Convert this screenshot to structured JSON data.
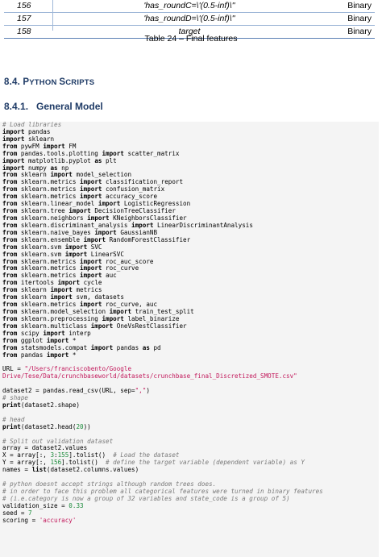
{
  "table": {
    "rows": [
      {
        "num": "156",
        "feature": "'has_roundC=\\'(0.5-inf)\\''",
        "type": "Binary"
      },
      {
        "num": "157",
        "feature": "'has_roundD=\\'(0.5-inf)\\''",
        "type": "Binary"
      },
      {
        "num": "158",
        "feature": "target",
        "type": "Binary"
      }
    ],
    "caption": "Table 24 – Final features"
  },
  "section_heading": {
    "number": "8.4.",
    "first_letter": "P",
    "rest1": "YTHON ",
    "first_letter2": "S",
    "rest2": "CRIPTS"
  },
  "subsection_heading": "8.4.1.   General Model",
  "code_lines": [
    [
      [
        "com",
        "# Load libraries"
      ]
    ],
    [
      [
        "kw",
        "import"
      ],
      [
        "",
        " pandas"
      ]
    ],
    [
      [
        "kw",
        "import"
      ],
      [
        "",
        " sklearn"
      ]
    ],
    [
      [
        "kw",
        "from"
      ],
      [
        "",
        " pywFM "
      ],
      [
        "kw",
        "import"
      ],
      [
        "",
        " FM"
      ]
    ],
    [
      [
        "kw",
        "from"
      ],
      [
        "",
        " pandas.tools.plotting "
      ],
      [
        "kw",
        "import"
      ],
      [
        "",
        " scatter_matrix"
      ]
    ],
    [
      [
        "kw",
        "import"
      ],
      [
        "",
        " matplotlib.pyplot "
      ],
      [
        "kw",
        "as"
      ],
      [
        "",
        " plt"
      ]
    ],
    [
      [
        "kw",
        "import"
      ],
      [
        "",
        " numpy "
      ],
      [
        "kw",
        "as"
      ],
      [
        "",
        " np"
      ]
    ],
    [
      [
        "kw",
        "from"
      ],
      [
        "",
        " sklearn "
      ],
      [
        "kw",
        "import"
      ],
      [
        "",
        " model_selection"
      ]
    ],
    [
      [
        "kw",
        "from"
      ],
      [
        "",
        " sklearn.metrics "
      ],
      [
        "kw",
        "import"
      ],
      [
        "",
        " classification_report"
      ]
    ],
    [
      [
        "kw",
        "from"
      ],
      [
        "",
        " sklearn.metrics "
      ],
      [
        "kw",
        "import"
      ],
      [
        "",
        " confusion_matrix"
      ]
    ],
    [
      [
        "kw",
        "from"
      ],
      [
        "",
        " sklearn.metrics "
      ],
      [
        "kw",
        "import"
      ],
      [
        "",
        " accuracy_score"
      ]
    ],
    [
      [
        "kw",
        "from"
      ],
      [
        "",
        " sklearn.linear_model "
      ],
      [
        "kw",
        "import"
      ],
      [
        "",
        " LogisticRegression"
      ]
    ],
    [
      [
        "kw",
        "from"
      ],
      [
        "",
        " sklearn.tree "
      ],
      [
        "kw",
        "import"
      ],
      [
        "",
        " DecisionTreeClassifier"
      ]
    ],
    [
      [
        "kw",
        "from"
      ],
      [
        "",
        " sklearn.neighbors "
      ],
      [
        "kw",
        "import"
      ],
      [
        "",
        " KNeighborsClassifier"
      ]
    ],
    [
      [
        "kw",
        "from"
      ],
      [
        "",
        " sklearn.discriminant_analysis "
      ],
      [
        "kw",
        "import"
      ],
      [
        "",
        " LinearDiscriminantAnalysis"
      ]
    ],
    [
      [
        "kw",
        "from"
      ],
      [
        "",
        " sklearn.naive_bayes "
      ],
      [
        "kw",
        "import"
      ],
      [
        "",
        " GaussianNB"
      ]
    ],
    [
      [
        "kw",
        "from"
      ],
      [
        "",
        " sklearn.ensemble "
      ],
      [
        "kw",
        "import"
      ],
      [
        "",
        " RandomForestClassifier"
      ]
    ],
    [
      [
        "kw",
        "from"
      ],
      [
        "",
        " sklearn.svm "
      ],
      [
        "kw",
        "import"
      ],
      [
        "",
        " SVC"
      ]
    ],
    [
      [
        "kw",
        "from"
      ],
      [
        "",
        " sklearn.svm "
      ],
      [
        "kw",
        "import"
      ],
      [
        "",
        " LinearSVC"
      ]
    ],
    [
      [
        "kw",
        "from"
      ],
      [
        "",
        " sklearn.metrics "
      ],
      [
        "kw",
        "import"
      ],
      [
        "",
        " roc_auc_score"
      ]
    ],
    [
      [
        "kw",
        "from"
      ],
      [
        "",
        " sklearn.metrics "
      ],
      [
        "kw",
        "import"
      ],
      [
        "",
        " roc_curve"
      ]
    ],
    [
      [
        "kw",
        "from"
      ],
      [
        "",
        " sklearn.metrics "
      ],
      [
        "kw",
        "import"
      ],
      [
        "",
        " auc"
      ]
    ],
    [
      [
        "kw",
        "from"
      ],
      [
        "",
        " itertools "
      ],
      [
        "kw",
        "import"
      ],
      [
        "",
        " cycle"
      ]
    ],
    [
      [
        "kw",
        "from"
      ],
      [
        "",
        " sklearn "
      ],
      [
        "kw",
        "import"
      ],
      [
        "",
        " metrics"
      ]
    ],
    [
      [
        "kw",
        "from"
      ],
      [
        "",
        " sklearn "
      ],
      [
        "kw",
        "import"
      ],
      [
        "",
        " svm, datasets"
      ]
    ],
    [
      [
        "kw",
        "from"
      ],
      [
        "",
        " sklearn.metrics "
      ],
      [
        "kw",
        "import"
      ],
      [
        "",
        " roc_curve, auc"
      ]
    ],
    [
      [
        "kw",
        "from"
      ],
      [
        "",
        " sklearn.model_selection "
      ],
      [
        "kw",
        "import"
      ],
      [
        "",
        " train_test_split"
      ]
    ],
    [
      [
        "kw",
        "from"
      ],
      [
        "",
        " sklearn.preprocessing "
      ],
      [
        "kw",
        "import"
      ],
      [
        "",
        " label_binarize"
      ]
    ],
    [
      [
        "kw",
        "from"
      ],
      [
        "",
        " sklearn.multiclass "
      ],
      [
        "kw",
        "import"
      ],
      [
        "",
        " OneVsRestClassifier"
      ]
    ],
    [
      [
        "kw",
        "from"
      ],
      [
        "",
        " scipy "
      ],
      [
        "kw",
        "import"
      ],
      [
        "",
        " interp"
      ]
    ],
    [
      [
        "kw",
        "from"
      ],
      [
        "",
        " ggplot "
      ],
      [
        "kw",
        "import"
      ],
      [
        "",
        " *"
      ]
    ],
    [
      [
        "kw",
        "from"
      ],
      [
        "",
        " statsmodels.compat "
      ],
      [
        "kw",
        "import"
      ],
      [
        "",
        " pandas "
      ],
      [
        "kw",
        "as"
      ],
      [
        "",
        " pd"
      ]
    ],
    [
      [
        "kw",
        "from"
      ],
      [
        "",
        " pandas "
      ],
      [
        "kw",
        "import"
      ],
      [
        "",
        " *"
      ]
    ],
    [
      [
        "",
        ""
      ]
    ],
    [
      [
        "",
        "URL = "
      ],
      [
        "str",
        "\"/Users/franciscobento/Google"
      ]
    ],
    [
      [
        "str",
        "Drive/Tese/Data/crunchbaseworld/datasets/crunchbase_final_Discretized_SMOTE.csv\""
      ]
    ],
    [
      [
        "",
        ""
      ]
    ],
    [
      [
        "",
        "dataset2 = pandas.read_csv(URL, sep="
      ],
      [
        "str",
        "\",\""
      ],
      [
        "",
        ")"
      ]
    ],
    [
      [
        "com",
        "# shape"
      ]
    ],
    [
      [
        "fn",
        "print"
      ],
      [
        "",
        "(dataset2.shape)"
      ]
    ],
    [
      [
        "",
        ""
      ]
    ],
    [
      [
        "com",
        "# head"
      ]
    ],
    [
      [
        "fn",
        "print"
      ],
      [
        "",
        "(dataset2.head("
      ],
      [
        "num",
        "20"
      ],
      [
        "",
        "))"
      ]
    ],
    [
      [
        "",
        ""
      ]
    ],
    [
      [
        "com",
        "# Split out validation dataset"
      ]
    ],
    [
      [
        "",
        "array = dataset2.values"
      ]
    ],
    [
      [
        "",
        "X = array[:, "
      ],
      [
        "num",
        "3"
      ],
      [
        "",
        ":"
      ],
      [
        "num",
        "155"
      ],
      [
        "",
        "].tolist()  "
      ],
      [
        "com",
        "# Load the dataset"
      ]
    ],
    [
      [
        "",
        "Y = array[:, "
      ],
      [
        "num",
        "156"
      ],
      [
        "",
        "].tolist()  "
      ],
      [
        "com",
        "# define the target variable (dependent variable) as Y"
      ]
    ],
    [
      [
        "",
        "names = "
      ],
      [
        "fn",
        "list"
      ],
      [
        "",
        "(dataset2.columns.values)"
      ]
    ],
    [
      [
        "",
        ""
      ]
    ],
    [
      [
        "com",
        "# python doesnt accept strings although random trees does."
      ]
    ],
    [
      [
        "com",
        "# in order to face this problem all categorical features were turned in binary features"
      ]
    ],
    [
      [
        "com",
        "# (i.e.category is now a group of 32 variables and state_code is a group of 5)"
      ]
    ],
    [
      [
        "",
        "validation_size = "
      ],
      [
        "num",
        "0.33"
      ]
    ],
    [
      [
        "",
        "seed = "
      ],
      [
        "num",
        "7"
      ]
    ],
    [
      [
        "",
        "scoring = "
      ],
      [
        "str",
        "'accuracy'"
      ]
    ]
  ]
}
